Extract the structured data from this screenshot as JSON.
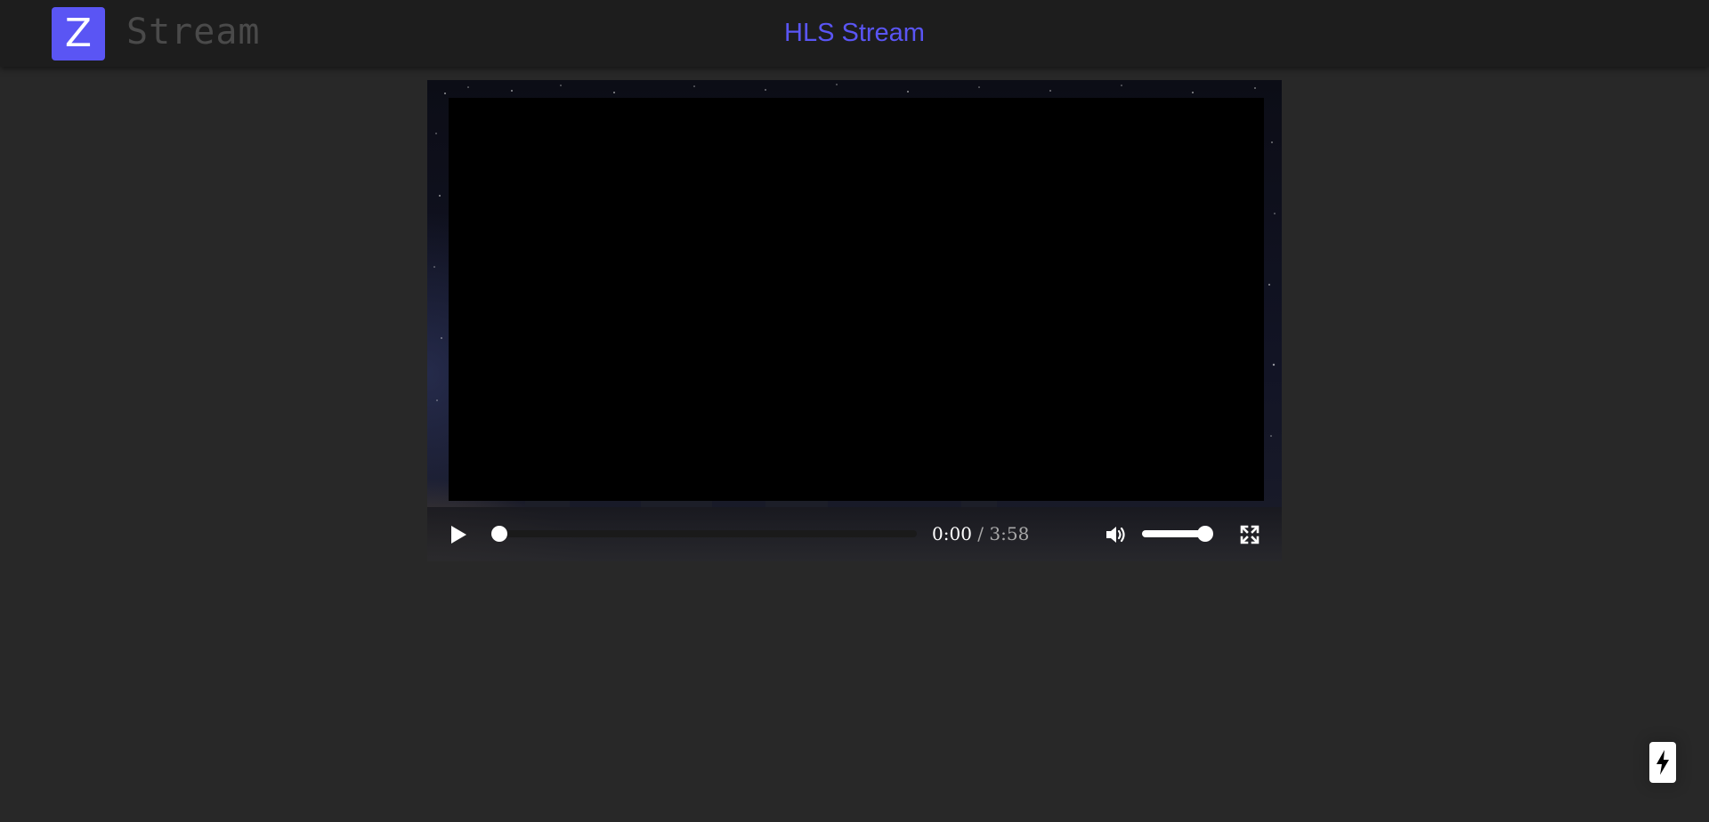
{
  "app": {
    "logo_letter": "Z",
    "brand_name": "Stream",
    "page_title": "HLS Stream"
  },
  "colors": {
    "accent": "#5a55f4",
    "background": "#282828",
    "navbar": "#1d1d1d",
    "brand_text": "#4a4a4a"
  },
  "player": {
    "current_time": "0:00",
    "separator": "/",
    "duration": "3:58",
    "progress_fraction": 0.0,
    "volume_fraction": 1.0,
    "state": "paused",
    "icons": {
      "play": "play-icon",
      "volume": "volume-up-icon",
      "fullscreen": "fullscreen-icon"
    }
  },
  "floating_action": {
    "icon": "lightning-bolt-icon"
  }
}
